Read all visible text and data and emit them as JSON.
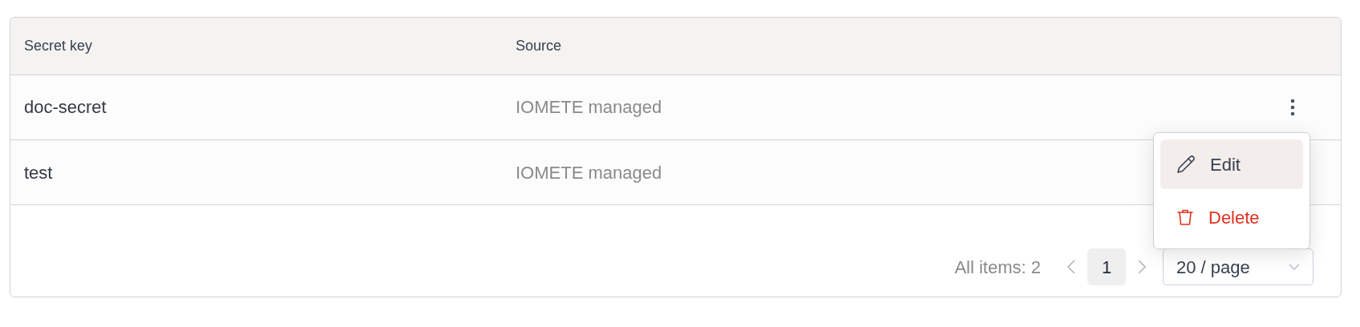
{
  "table": {
    "columns": [
      "Secret key",
      "Source"
    ],
    "rows": [
      {
        "secret_key": "doc-secret",
        "source": "IOMETE managed"
      },
      {
        "secret_key": "test",
        "source": "IOMETE managed"
      }
    ]
  },
  "row_menu": {
    "items": [
      {
        "kind": "edit",
        "label": "Edit",
        "selected": true
      },
      {
        "kind": "delete",
        "label": "Delete",
        "selected": false
      }
    ]
  },
  "pagination": {
    "total": "All items: 2",
    "pages": [
      {
        "label": "1",
        "selected": true
      }
    ],
    "page_size": "20 / page"
  }
}
